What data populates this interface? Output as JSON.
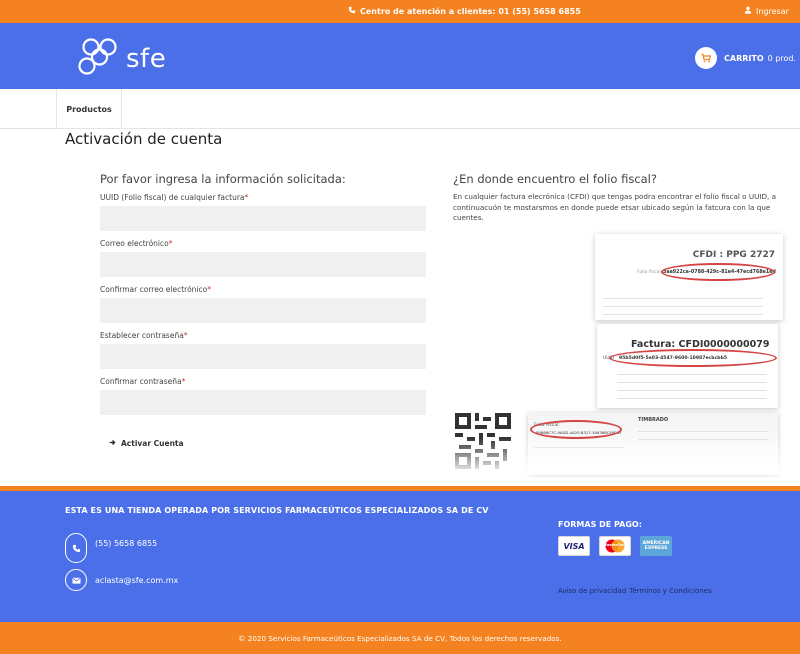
{
  "topbar": {
    "contact_label": "Centro de atención a clientes: 01 (55) 5658 6855",
    "login_label": "Ingresar"
  },
  "header": {
    "logo_text": "sfe",
    "cart_label": "CARRITO",
    "cart_count": "0 prod."
  },
  "nav": {
    "items": [
      {
        "label": "Productos"
      }
    ]
  },
  "page": {
    "title": "Activación de cuenta"
  },
  "form": {
    "heading": "Por favor ingresa la información solicitada:",
    "required_mark": "*",
    "fields": [
      {
        "label": "UUID (Folio fiscal) de cualquier factura",
        "value": ""
      },
      {
        "label": "Correo electrónico",
        "value": ""
      },
      {
        "label": "Confirmar correo electrónico",
        "value": ""
      },
      {
        "label": "Establecer contraseña",
        "value": ""
      },
      {
        "label": "Confirmar contraseña",
        "value": ""
      }
    ],
    "submit_label": "Activar Cuenta"
  },
  "help": {
    "heading": "¿En donde encuentro el folio fiscal?",
    "text": "En cualquier factura elecrónica (CFDI) que tengas podra encontrar el folio fiscal o UUID, a continuacuón te mostarsmos en donde puede etsar ubicado según la fatcura con la que cuentes.",
    "example1_title": "CFDI : PPG 2727",
    "example1_folio_label": "Folio fiscal:",
    "example1_folio": "3aa922ca-0788-429c-81e4-47ecd768e1ed",
    "example2_title": "Factura: CFDI0000000079",
    "example2_folio": "95b5d0f5-5e03-4547-9600-10987ecbcbb5",
    "example2_label": "UUID",
    "example3_title": "TIMBRADO",
    "example3_label": "Folio Fiscal:",
    "example3_folio": "89B6BC7C-9ADD-4A20-B327-3A836BCE8F83"
  },
  "footer": {
    "title": "ESTA ES UNA TIENDA OPERADA POR SERVICIOS FARMACEÚTICOS ESPECIALIZADOS SA DE CV",
    "phone": "(55) 5658 6855",
    "email": "aclasta@sfe.com.mx",
    "payment_title": "FORMAS DE PAGO:",
    "payment_cards": [
      "VISA",
      "MasterCard",
      "AMERICAN EXPRESS"
    ],
    "privacy_link": "Aviso de privacidad",
    "terms_link": "Términos y Condiciones",
    "copyright": "© 2020 Servicios Farmaceúticos Especializados SA de CV, Todos los derechos reservados."
  },
  "colors": {
    "orange": "#f58220",
    "blue": "#4b6fe8",
    "input_bg": "#f0f0f0",
    "required": "#c0392b",
    "highlight": "#d64545"
  },
  "icons": [
    "phone-icon",
    "user-icon",
    "logo-icon",
    "cart-icon",
    "arrow-right-icon",
    "mail-icon"
  ]
}
